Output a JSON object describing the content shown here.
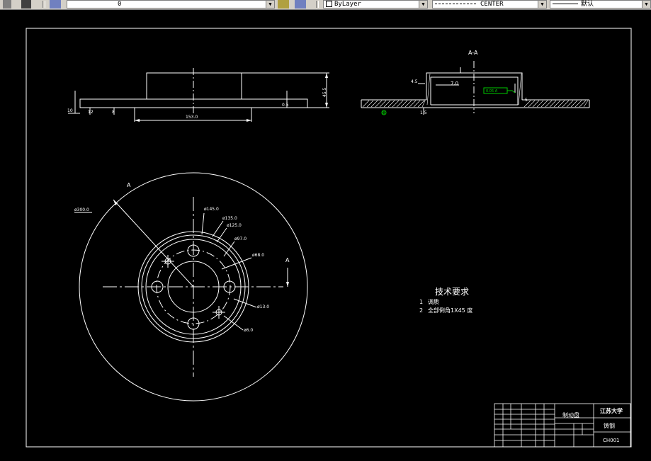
{
  "toolbar": {
    "layer_value": "0",
    "color_value": "ByLayer",
    "linetype_value": "CENTER",
    "lineweight_value": "默认"
  },
  "drawing": {
    "top_view": {
      "dim_height": "45.5",
      "dim_left": "10",
      "dim_base": "153.0",
      "dim_small": "0.5",
      "dim_b": "12",
      "dim_c": "8"
    },
    "section": {
      "title": "A-A",
      "dim_thickness": "7.0",
      "dim_left": "4.5",
      "dim_right": "5",
      "dim_bottom": "1.5",
      "tolerance_box": "0.05 A",
      "datum_mark": "B"
    },
    "front_view": {
      "cut_label_left": "A",
      "cut_label_right": "A",
      "dim_outer": "ø300.0",
      "dim_145": "ø145.0",
      "dim_135": "ø135.0",
      "dim_125": "ø125.0",
      "dim_97": "ø97.0",
      "dim_68": "ø68.0",
      "dim_13": "ø13.0",
      "dim_6": "ø6.0"
    },
    "tech_req": {
      "title": "技术要求",
      "item1_num": "1",
      "item1_text": "调质",
      "item2_num": "2",
      "item2_text": "全部倒角1X45 度"
    },
    "title_block": {
      "part_name": "制动盘",
      "school": "江苏大学",
      "material": "铸钢",
      "drawing_no": "CH001"
    }
  },
  "colors": {
    "lines": "#ffffff",
    "highlight": "#00cc00",
    "toolbar_bg": "#d4d0c8"
  }
}
